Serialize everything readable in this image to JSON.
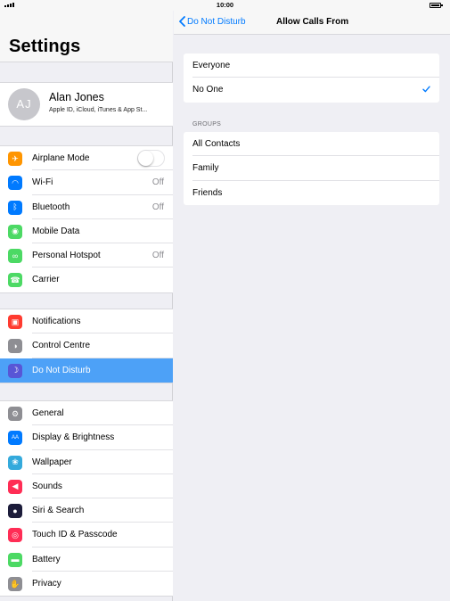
{
  "status": {
    "time": "10:00"
  },
  "sidebar": {
    "title": "Settings",
    "profile": {
      "initials": "AJ",
      "name": "Alan Jones",
      "subtitle": "Apple ID, iCloud, iTunes & App St..."
    },
    "groups": [
      [
        {
          "label": "Airplane Mode",
          "icon": "airplane-icon",
          "color": "#ff9500",
          "control": "toggle-off"
        },
        {
          "label": "Wi-Fi",
          "icon": "wifi-icon",
          "color": "#007aff",
          "value": "Off"
        },
        {
          "label": "Bluetooth",
          "icon": "bluetooth-icon",
          "color": "#007aff",
          "value": "Off"
        },
        {
          "label": "Mobile Data",
          "icon": "antenna-icon",
          "color": "#4cd964"
        },
        {
          "label": "Personal Hotspot",
          "icon": "hotspot-icon",
          "color": "#4cd964",
          "value": "Off"
        },
        {
          "label": "Carrier",
          "icon": "phone-icon",
          "color": "#4cd964"
        }
      ],
      [
        {
          "label": "Notifications",
          "icon": "notifications-icon",
          "color": "#ff3b30"
        },
        {
          "label": "Control Centre",
          "icon": "control-centre-icon",
          "color": "#8e8e93"
        },
        {
          "label": "Do Not Disturb",
          "icon": "moon-icon",
          "color": "#5856d6",
          "selected": true
        }
      ],
      [
        {
          "label": "General",
          "icon": "gear-icon",
          "color": "#8e8e93"
        },
        {
          "label": "Display & Brightness",
          "icon": "text-size-icon",
          "color": "#007aff"
        },
        {
          "label": "Wallpaper",
          "icon": "flower-icon",
          "color": "#34aadc"
        },
        {
          "label": "Sounds",
          "icon": "speaker-icon",
          "color": "#ff2d55"
        },
        {
          "label": "Siri & Search",
          "icon": "siri-icon",
          "color": "#1c1c3a"
        },
        {
          "label": "Touch ID & Passcode",
          "icon": "fingerprint-icon",
          "color": "#ff2d55"
        },
        {
          "label": "Battery",
          "icon": "battery-icon",
          "color": "#4cd964"
        },
        {
          "label": "Privacy",
          "icon": "hand-icon",
          "color": "#8e8e93"
        }
      ]
    ]
  },
  "detail": {
    "back_label": "Do Not Disturb",
    "title": "Allow Calls From",
    "options": [
      {
        "label": "Everyone",
        "checked": false
      },
      {
        "label": "No One",
        "checked": true
      }
    ],
    "groups_header": "GROUPS",
    "groups": [
      {
        "label": "All Contacts"
      },
      {
        "label": "Family"
      },
      {
        "label": "Friends"
      }
    ],
    "accent": "#007aff"
  }
}
